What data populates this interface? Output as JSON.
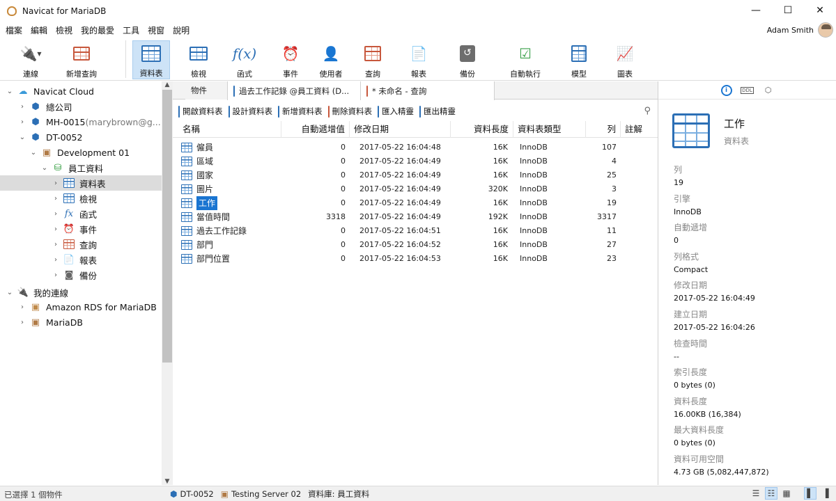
{
  "window": {
    "title": "Navicat for MariaDB",
    "minimize": "—",
    "maximize": "☐",
    "close": "✕"
  },
  "menu": [
    "檔案",
    "編輯",
    "檢視",
    "我的最愛",
    "工具",
    "視窗",
    "說明"
  ],
  "user": {
    "name": "Adam Smith"
  },
  "toolbar": [
    {
      "label": "連線",
      "icon": "plug-icon"
    },
    {
      "label": "新增查詢",
      "icon": "new-query-icon"
    },
    {
      "label": "資料表",
      "icon": "table-icon",
      "active": true
    },
    {
      "label": "檢視",
      "icon": "view-icon"
    },
    {
      "label": "函式",
      "icon": "function-icon"
    },
    {
      "label": "事件",
      "icon": "event-clock-icon"
    },
    {
      "label": "使用者",
      "icon": "user-icon"
    },
    {
      "label": "查詢",
      "icon": "query-icon"
    },
    {
      "label": "報表",
      "icon": "report-icon"
    },
    {
      "label": "備份",
      "icon": "backup-icon"
    },
    {
      "label": "自動執行",
      "icon": "automation-icon"
    },
    {
      "label": "模型",
      "icon": "model-icon"
    },
    {
      "label": "圖表",
      "icon": "chart-icon"
    }
  ],
  "tree": [
    {
      "label": "Navicat Cloud",
      "sub": "",
      "level": 0,
      "expanded": true,
      "icon": "cloud-icon"
    },
    {
      "label": "總公司",
      "sub": "",
      "level": 1,
      "expanded": false,
      "icon": "project-icon"
    },
    {
      "label": "MH-0015",
      "sub": " (marybrown@g...",
      "level": 1,
      "expanded": false,
      "icon": "shared-project-icon"
    },
    {
      "label": "DT-0052",
      "sub": "",
      "level": 1,
      "expanded": true,
      "icon": "shared-project-icon"
    },
    {
      "label": "Development 01",
      "sub": "",
      "level": 2,
      "expanded": true,
      "icon": "mariadb-connection-icon"
    },
    {
      "label": "員工資料",
      "sub": "",
      "level": 3,
      "expanded": true,
      "icon": "database-icon"
    },
    {
      "label": "資料表",
      "sub": "",
      "level": 4,
      "expanded": false,
      "icon": "table-icon",
      "selected": true
    },
    {
      "label": "檢視",
      "sub": "",
      "level": 4,
      "expanded": false,
      "icon": "view-icon"
    },
    {
      "label": "函式",
      "sub": "",
      "level": 4,
      "expanded": false,
      "icon": "function-icon"
    },
    {
      "label": "事件",
      "sub": "",
      "level": 4,
      "expanded": false,
      "icon": "event-clock-icon"
    },
    {
      "label": "查詢",
      "sub": "",
      "level": 4,
      "expanded": false,
      "icon": "query-icon"
    },
    {
      "label": "報表",
      "sub": "",
      "level": 4,
      "expanded": false,
      "icon": "report-icon"
    },
    {
      "label": "備份",
      "sub": "",
      "level": 4,
      "expanded": false,
      "icon": "backup-icon"
    },
    {
      "label": "我的連線",
      "sub": "",
      "level": 0,
      "expanded": true,
      "icon": "connections-icon"
    },
    {
      "label": "Amazon RDS for MariaDB",
      "sub": "",
      "level": 1,
      "expanded": false,
      "icon": "rds-icon"
    },
    {
      "label": "MariaDB",
      "sub": "",
      "level": 1,
      "expanded": false,
      "icon": "mariadb-connection-icon"
    }
  ],
  "tabs": {
    "objects": "物件",
    "tab1": "過去工作記錄 @員工資料 (D...",
    "tab2": "* 未命名 - 查詢"
  },
  "objbar": {
    "open": "開啟資料表",
    "design": "設計資料表",
    "new": "新增資料表",
    "delete": "刪除資料表",
    "import": "匯入精靈",
    "export": "匯出精靈"
  },
  "columns": [
    "名稱",
    "自動遞增值",
    "修改日期",
    "資料長度",
    "資料表類型",
    "列",
    "註解"
  ],
  "rows": [
    {
      "name": "僱員",
      "auto": "0",
      "date": "2017-05-22 16:04:48",
      "len": "16K",
      "type": "InnoDB",
      "rows": "107"
    },
    {
      "name": "區域",
      "auto": "0",
      "date": "2017-05-22 16:04:49",
      "len": "16K",
      "type": "InnoDB",
      "rows": "4"
    },
    {
      "name": "國家",
      "auto": "0",
      "date": "2017-05-22 16:04:49",
      "len": "16K",
      "type": "InnoDB",
      "rows": "25"
    },
    {
      "name": "圖片",
      "auto": "0",
      "date": "2017-05-22 16:04:49",
      "len": "320K",
      "type": "InnoDB",
      "rows": "3"
    },
    {
      "name": "工作",
      "auto": "0",
      "date": "2017-05-22 16:04:49",
      "len": "16K",
      "type": "InnoDB",
      "rows": "19",
      "selected": true
    },
    {
      "name": "當值時間",
      "auto": "3318",
      "date": "2017-05-22 16:04:49",
      "len": "192K",
      "type": "InnoDB",
      "rows": "3317"
    },
    {
      "name": "過去工作記錄",
      "auto": "0",
      "date": "2017-05-22 16:04:51",
      "len": "16K",
      "type": "InnoDB",
      "rows": "11"
    },
    {
      "name": "部門",
      "auto": "0",
      "date": "2017-05-22 16:04:52",
      "len": "16K",
      "type": "InnoDB",
      "rows": "27"
    },
    {
      "name": "部門位置",
      "auto": "0",
      "date": "2017-05-22 16:04:53",
      "len": "16K",
      "type": "InnoDB",
      "rows": "23"
    }
  ],
  "info": {
    "title": "工作",
    "subtitle": "資料表",
    "props": [
      {
        "k": "列",
        "v": "19"
      },
      {
        "k": "引擎",
        "v": "InnoDB"
      },
      {
        "k": "自動遞增",
        "v": "0"
      },
      {
        "k": "列格式",
        "v": "Compact"
      },
      {
        "k": "修改日期",
        "v": "2017-05-22 16:04:49"
      },
      {
        "k": "建立日期",
        "v": "2017-05-22 16:04:26"
      },
      {
        "k": "檢查時間",
        "v": "--"
      },
      {
        "k": "索引長度",
        "v": "0 bytes (0)"
      },
      {
        "k": "資料長度",
        "v": "16.00KB (16,384)"
      },
      {
        "k": "最大資料長度",
        "v": "0 bytes (0)"
      },
      {
        "k": "資料可用空間",
        "v": "4.73 GB (5,082,447,872)"
      }
    ]
  },
  "status": {
    "selection": "已選擇 1 個物件",
    "project": "DT-0052",
    "server": "Testing Server 02",
    "database": "資料庫: 員工資料"
  },
  "colors": {
    "accent": "#1a75d1",
    "toolbar_active": "#cde3f7",
    "table_icon": "#2c6fb5"
  }
}
